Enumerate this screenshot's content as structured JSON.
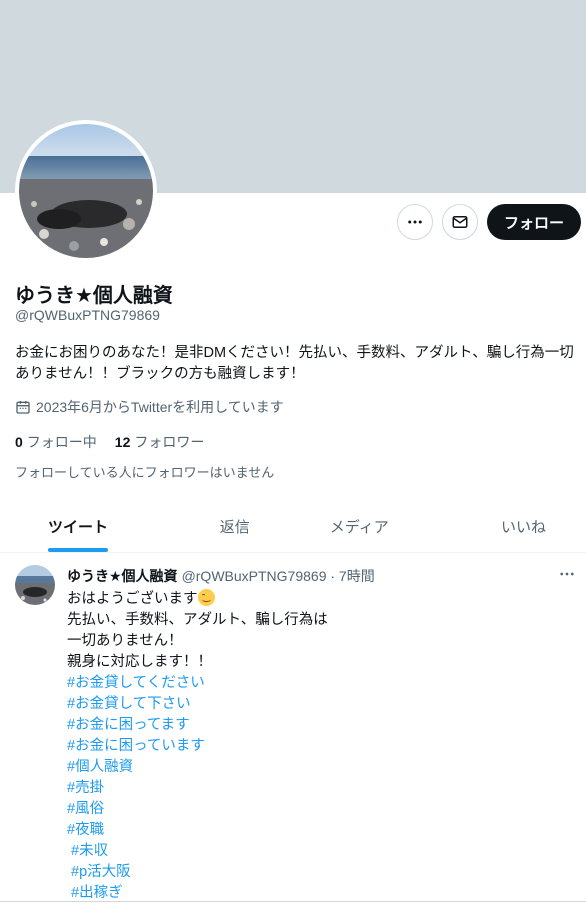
{
  "profile": {
    "name": "ゆうき★個人融資",
    "handle": "@rQWBuxPTNG79869",
    "bio": "お金にお困りのあなた！是非DMください！先払い、手数料、アダルト、騙し行為一切ありません！！ブラックの方も融資します！",
    "joined": "2023年6月からTwitterを利用しています",
    "following_count": "0",
    "following_label": "フォロー中",
    "followers_count": "12",
    "followers_label": "フォロワー",
    "followers_note": "フォローしている人にフォロワーはいません"
  },
  "actions": {
    "more_icon": "more-horizontal-icon",
    "message_icon": "envelope-icon",
    "follow_label": "フォロー"
  },
  "tabs": [
    {
      "label": "ツイート",
      "active": true
    },
    {
      "label": "返信",
      "active": false
    },
    {
      "label": "メディア",
      "active": false
    },
    {
      "label": "いいね",
      "active": false
    }
  ],
  "tweet": {
    "name": "ゆうき★個人融資",
    "meta": "@rQWBuxPTNG79869 · 7時間",
    "lines": [
      "おはようございます",
      "先払い、手数料、アダルト、騙し行為は",
      "一切ありません！",
      "親身に対応します！！"
    ],
    "hashtags": [
      "#お金貸してください",
      "#お金貸して下さい",
      "#お金に困ってます",
      "#お金に困っています",
      "#個人融資",
      "#売掛",
      "#風俗",
      "#夜職",
      " #未収",
      " #p活大阪",
      " #出稼ぎ"
    ]
  },
  "colors": {
    "banner": "#cfd9de",
    "accent": "#1d9bf0",
    "text": "#0f1419",
    "secondary": "#536471"
  }
}
